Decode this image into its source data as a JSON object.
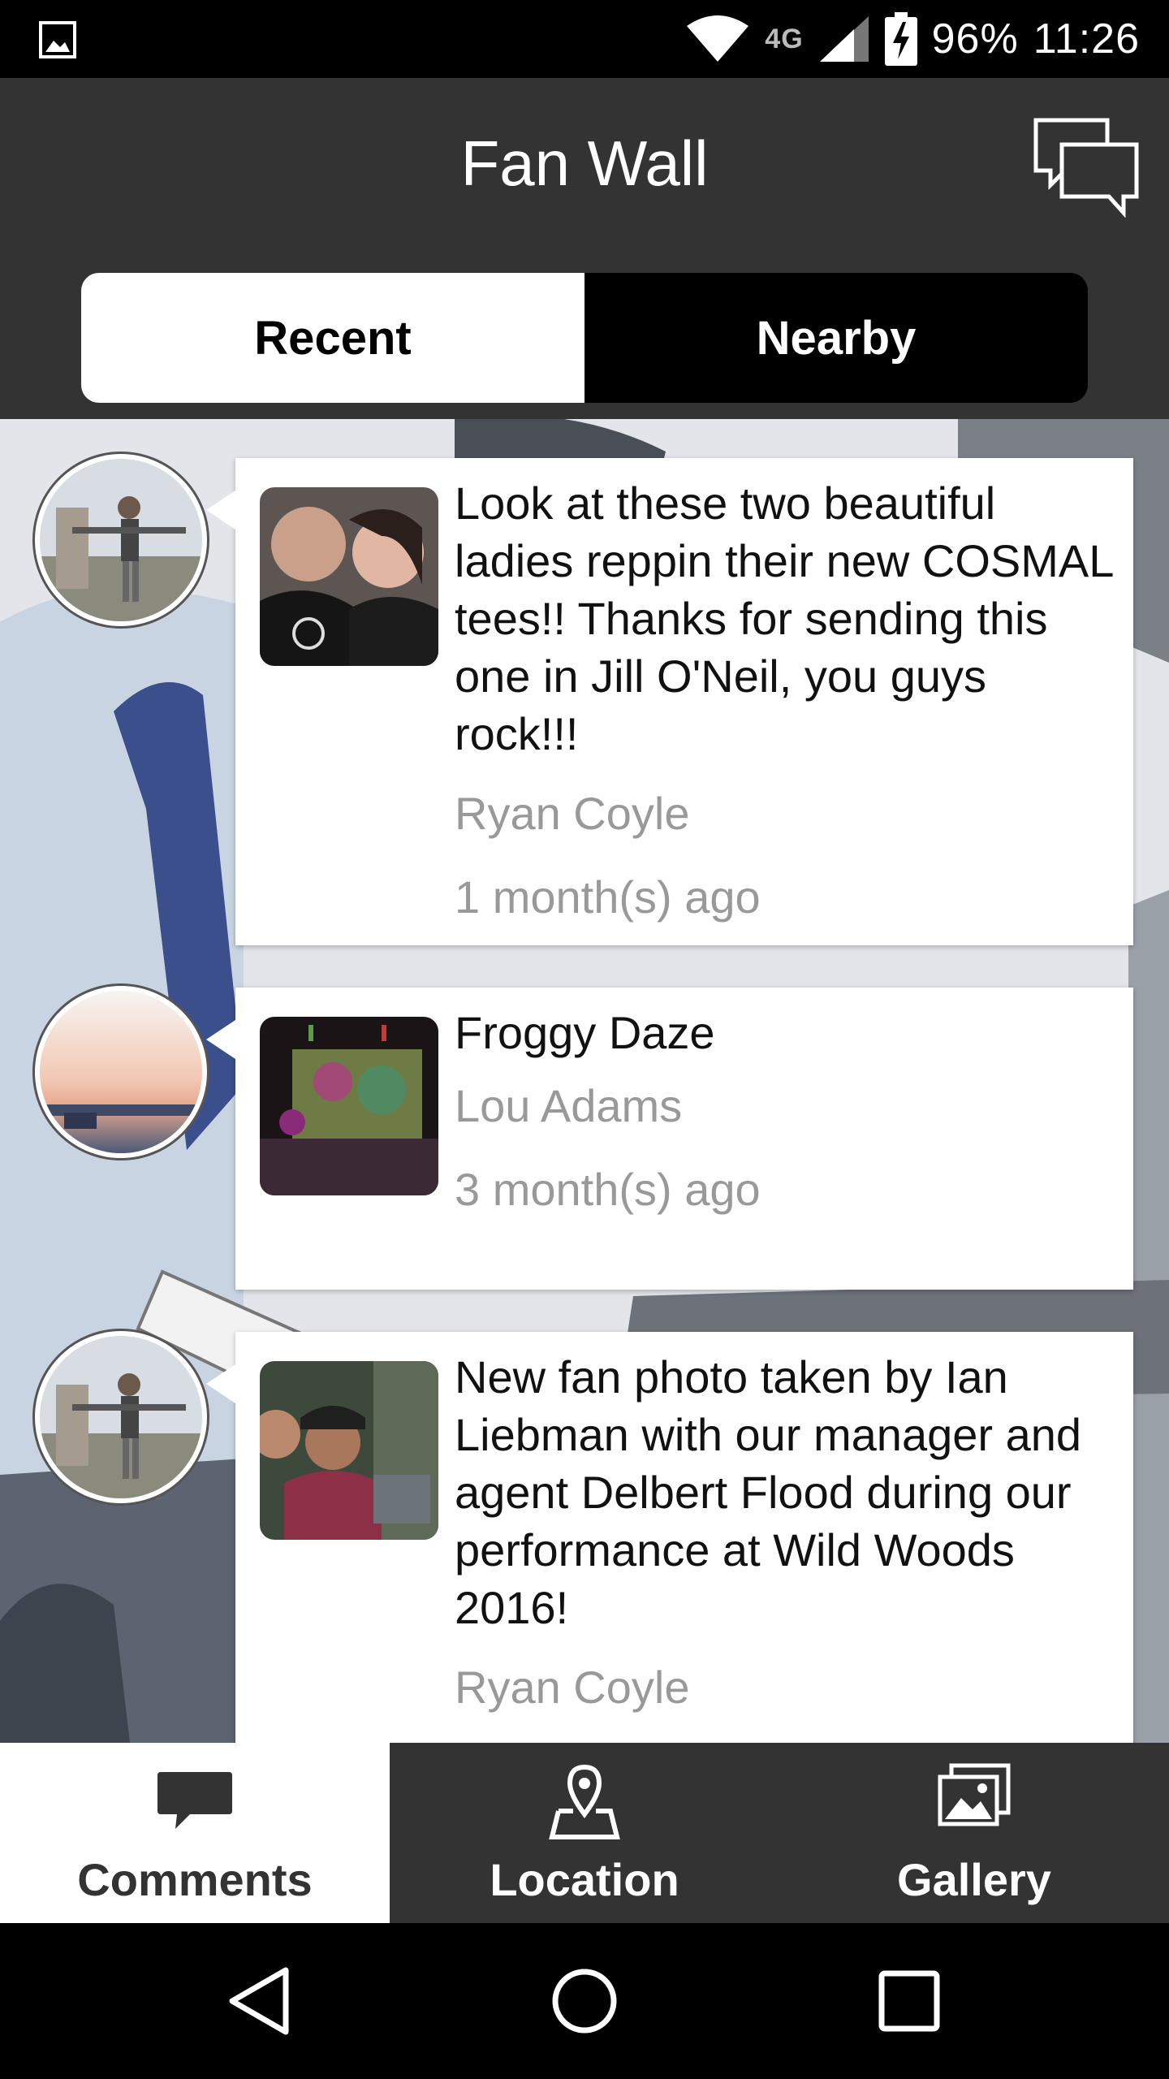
{
  "status_bar": {
    "network": "4G",
    "battery": "96%",
    "time": "11:26"
  },
  "header": {
    "title": "Fan Wall",
    "chat_icon": "chat-bubbles-icon"
  },
  "segments": {
    "recent": "Recent",
    "nearby": "Nearby",
    "selected": "Recent"
  },
  "posts": [
    {
      "message": "Look at these two beautiful ladies reppin their new COSMAL tees!! Thanks for sending this one in Jill O'Neil, you guys rock!!!",
      "author": "Ryan Coyle",
      "time": "1 month(s) ago"
    },
    {
      "message": "Froggy Daze",
      "author": "Lou Adams",
      "time": "3 month(s) ago"
    },
    {
      "message": "New fan photo taken by Ian Liebman with our manager and agent Delbert Flood during our performance at Wild Woods 2016!",
      "author": "Ryan Coyle",
      "time": ""
    }
  ],
  "tabs": {
    "comments": "Comments",
    "location": "Location",
    "gallery": "Gallery",
    "active": "Comments"
  },
  "colors": {
    "header_bg": "#333333",
    "tab_bg": "#333333",
    "secondary_text": "#999999"
  }
}
